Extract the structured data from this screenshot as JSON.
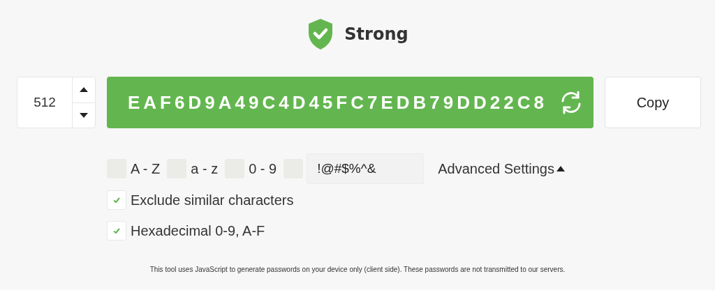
{
  "strength": {
    "label": "Strong"
  },
  "length": {
    "value": "512"
  },
  "password": {
    "value": "EAF6D9A49C4D45FC7EDB79DD22C8"
  },
  "copy_button": {
    "label": "Copy"
  },
  "char_sets": [
    {
      "label": "A - Z",
      "checked": false
    },
    {
      "label": "a - z",
      "checked": false
    },
    {
      "label": "0 - 9",
      "checked": false
    },
    {
      "checked": false,
      "value": "!@#$%^&"
    }
  ],
  "advanced_settings": {
    "label": "Advanced Settings",
    "expanded": true
  },
  "options": [
    {
      "label": "Exclude similar characters",
      "checked": true
    },
    {
      "label": "Hexadecimal 0-9, A-F",
      "checked": true
    }
  ],
  "footnote": "This tool uses JavaScript to generate passwords on your device only (client side). These passwords are not transmitted to our servers."
}
